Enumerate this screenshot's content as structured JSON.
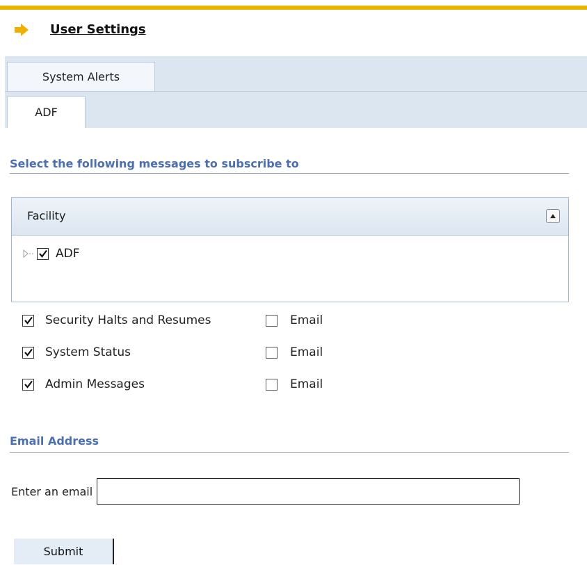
{
  "header": {
    "title": "User Settings"
  },
  "tabs": [
    {
      "label": "System Alerts"
    },
    {
      "label": "ADF"
    }
  ],
  "subscribe_section": {
    "title": "Select the following messages to subscribe to"
  },
  "facility_grid": {
    "header_label": "Facility",
    "items": [
      {
        "label": "ADF",
        "checked": true
      }
    ]
  },
  "options": [
    {
      "label": "Security Halts and Resumes",
      "checked": true,
      "email_label": "Email",
      "email_checked": false
    },
    {
      "label": "System Status",
      "checked": true,
      "email_label": "Email",
      "email_checked": false
    },
    {
      "label": "Admin Messages",
      "checked": true,
      "email_label": "Email",
      "email_checked": false
    }
  ],
  "email_section": {
    "title": "Email Address",
    "field_label": "Enter an email",
    "value": "",
    "placeholder": ""
  },
  "submit": {
    "label": "Submit"
  },
  "colors": {
    "accent_bar": "#e7b400",
    "section_title": "#4a6fb5",
    "tab_strip": "#dbe6f1"
  }
}
